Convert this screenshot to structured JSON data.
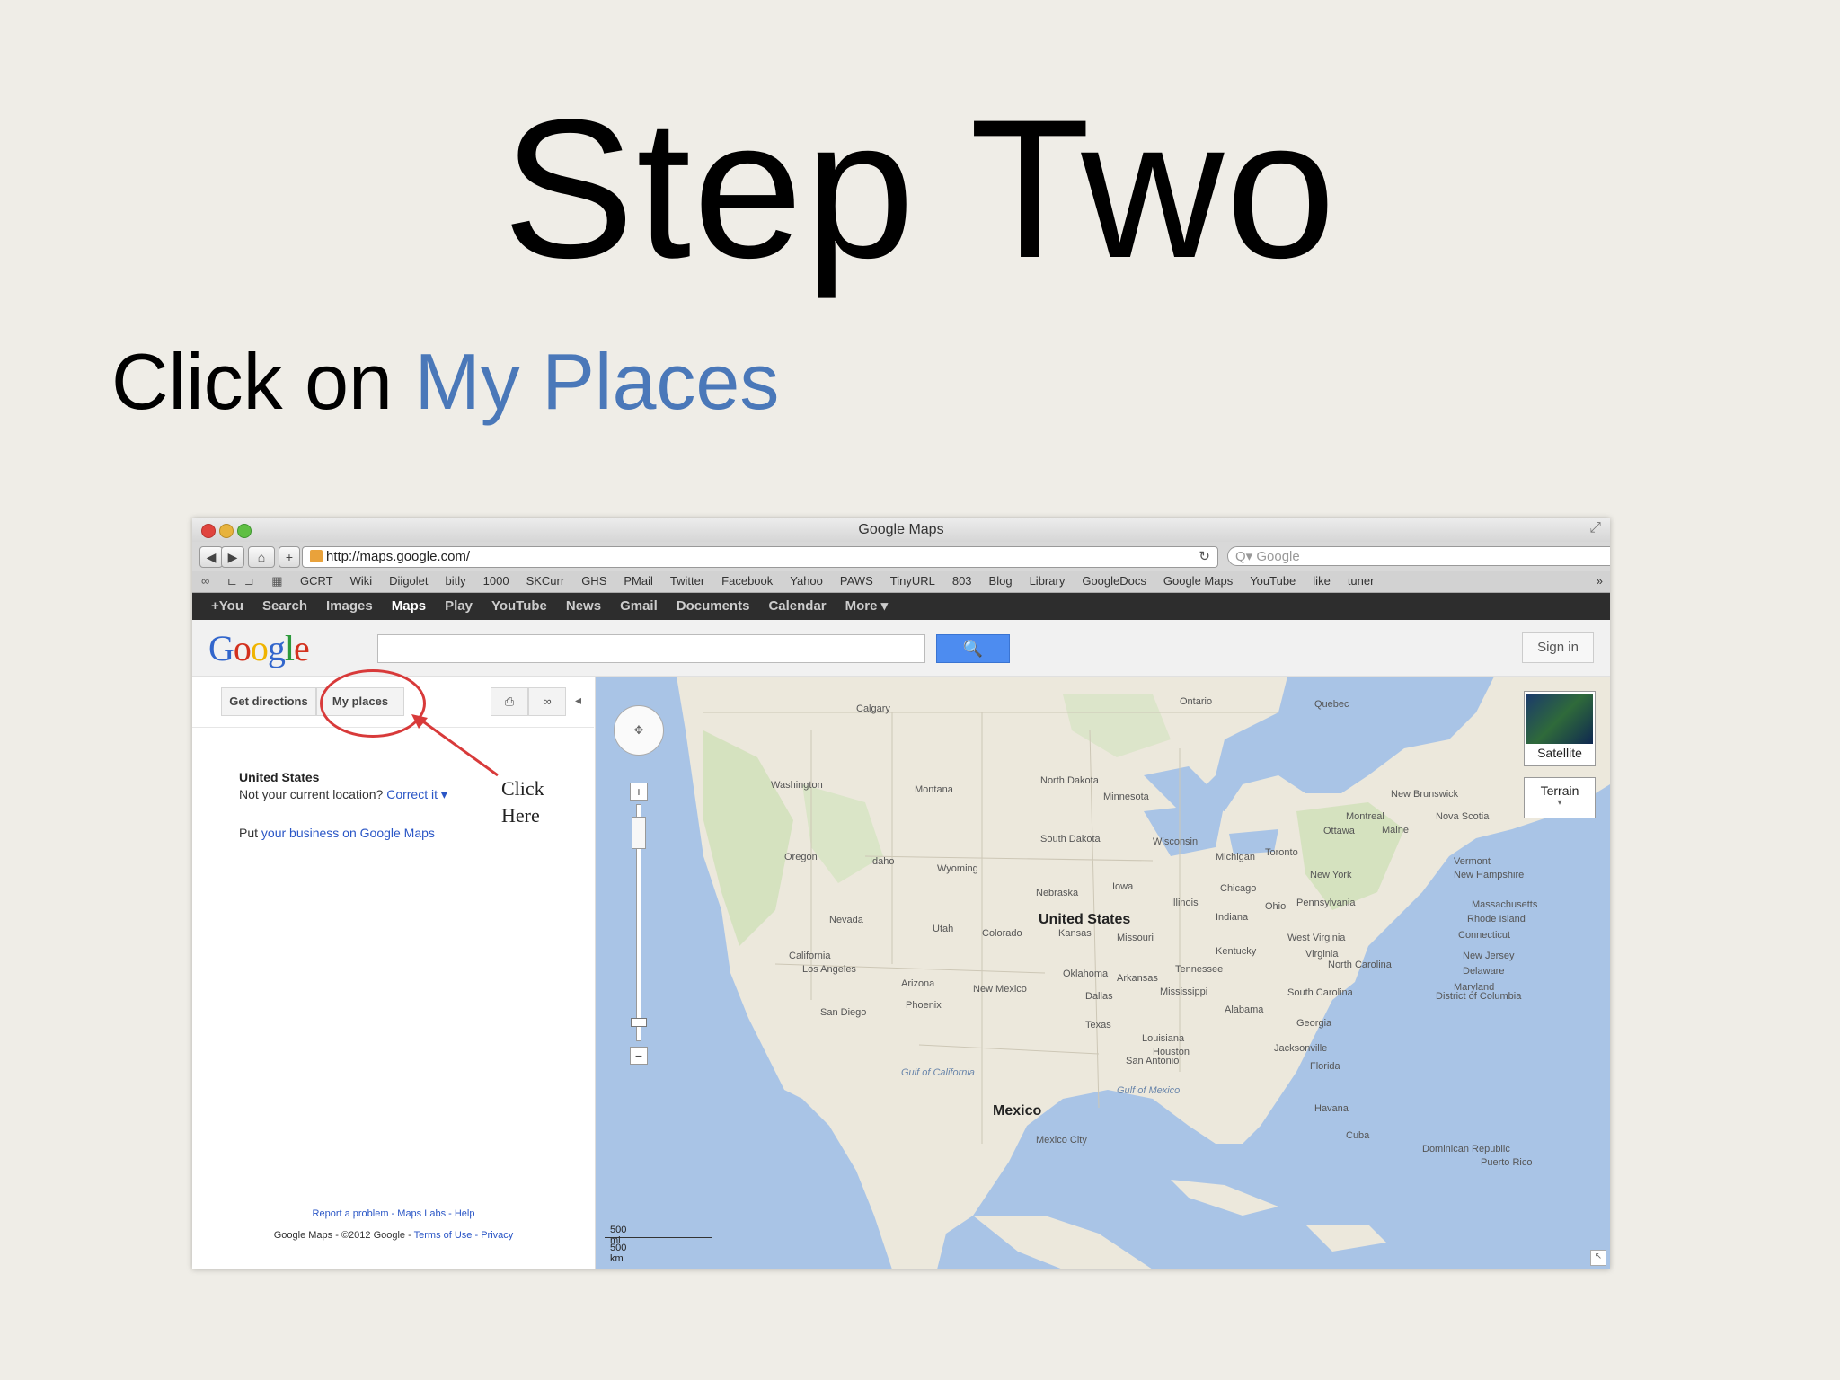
{
  "slide": {
    "title": "Step Two",
    "subtitle_prefix": "Click on ",
    "subtitle_highlight": "My Places"
  },
  "window": {
    "title": "Google Maps"
  },
  "toolbar": {
    "back": "◀",
    "forward": "▶",
    "home": "⌂",
    "add": "+",
    "url": "http://maps.google.com/",
    "reload": "↻",
    "search_placeholder": "Q▾ Google",
    "extension": "O"
  },
  "bookmarks": {
    "icons": "∞ ⊏⊐ ▦",
    "items": [
      "GCRT",
      "Wiki",
      "Diigolet",
      "bitly",
      "1000",
      "SKCurr",
      "GHS",
      "PMail",
      "Twitter",
      "Facebook",
      "Yahoo",
      "PAWS",
      "TinyURL",
      "803",
      "Blog",
      "Library",
      "GoogleDocs",
      "Google Maps",
      "YouTube",
      "like",
      "tuner"
    ],
    "more": "»"
  },
  "gbar": {
    "items": [
      "+You",
      "Search",
      "Images",
      "Maps",
      "Play",
      "YouTube",
      "News",
      "Gmail",
      "Documents",
      "Calendar",
      "More ▾"
    ],
    "active_index": 3
  },
  "header": {
    "logo": [
      "G",
      "o",
      "o",
      "g",
      "l",
      "e"
    ],
    "search_value": "",
    "search_icon": "🔍",
    "signin": "Sign in"
  },
  "left": {
    "get_directions": "Get directions",
    "my_places": "My places",
    "print_icon": "⎙",
    "link_icon": "∞",
    "collapse_icon": "◂",
    "location_title": "United States",
    "location_text": "Not your current location? ",
    "location_link": "Correct it ▾",
    "put_text": "Put ",
    "put_link": "your business on Google Maps",
    "annotation": "Click Here",
    "footer_links": "Report a problem - Maps Labs - Help",
    "footer_copyright": "Google Maps - ©2012 Google - ",
    "footer_terms": "Terms of Use - Privacy"
  },
  "map": {
    "labels": [
      {
        "t": "Calgary"
      },
      {
        "t": "Ontario"
      },
      {
        "t": "Quebec"
      },
      {
        "t": "Washington"
      },
      {
        "t": "Montana"
      },
      {
        "t": "North Dakota"
      },
      {
        "t": "Minnesota"
      },
      {
        "t": "Oregon"
      },
      {
        "t": "Idaho"
      },
      {
        "t": "Wyoming"
      },
      {
        "t": "South Dakota"
      },
      {
        "t": "Wisconsin"
      },
      {
        "t": "Michigan"
      },
      {
        "t": "Toronto"
      },
      {
        "t": "Ottawa"
      },
      {
        "t": "Montreal"
      },
      {
        "t": "Maine"
      },
      {
        "t": "New Brunswick"
      },
      {
        "t": "Nova Scotia"
      },
      {
        "t": "Nebraska"
      },
      {
        "t": "Iowa"
      },
      {
        "t": "Chicago"
      },
      {
        "t": "New York"
      },
      {
        "t": "Vermont"
      },
      {
        "t": "New Hampshire"
      },
      {
        "t": "Nevada"
      },
      {
        "t": "Utah"
      },
      {
        "t": "Colorado"
      },
      {
        "t": "United States"
      },
      {
        "t": "Illinois"
      },
      {
        "t": "Indiana"
      },
      {
        "t": "Ohio"
      },
      {
        "t": "Pennsylvania"
      },
      {
        "t": "Massachusetts"
      },
      {
        "t": "Rhode Island"
      },
      {
        "t": "California"
      },
      {
        "t": "Kansas"
      },
      {
        "t": "Missouri"
      },
      {
        "t": "West Virginia"
      },
      {
        "t": "Kentucky"
      },
      {
        "t": "Virginia"
      },
      {
        "t": "Connecticut"
      },
      {
        "t": "New Jersey"
      },
      {
        "t": "Delaware"
      },
      {
        "t": "Maryland"
      },
      {
        "t": "Los Angeles"
      },
      {
        "t": "Arizona"
      },
      {
        "t": "New Mexico"
      },
      {
        "t": "Oklahoma"
      },
      {
        "t": "Arkansas"
      },
      {
        "t": "Tennessee"
      },
      {
        "t": "North Carolina"
      },
      {
        "t": "Phoenix"
      },
      {
        "t": "San Diego"
      },
      {
        "t": "Dallas"
      },
      {
        "t": "Mississippi"
      },
      {
        "t": "Alabama"
      },
      {
        "t": "South Carolina"
      },
      {
        "t": "District of Columbia"
      },
      {
        "t": "Texas"
      },
      {
        "t": "Georgia"
      },
      {
        "t": "Louisiana"
      },
      {
        "t": "Houston"
      },
      {
        "t": "San Antonio"
      },
      {
        "t": "Jacksonville"
      },
      {
        "t": "Florida"
      },
      {
        "t": "Gulf of California"
      },
      {
        "t": "Gulf of Mexico"
      },
      {
        "t": "Mexico"
      },
      {
        "t": "Havana"
      },
      {
        "t": "Cuba"
      },
      {
        "t": "Mexico City"
      },
      {
        "t": "Dominican Republic"
      },
      {
        "t": "Puerto Rico"
      }
    ],
    "satellite": "Satellite",
    "terrain": "Terrain",
    "terrain_caret": "▾",
    "scale_mi": "500 mi",
    "scale_km": "500 km",
    "pan_icon": "✥",
    "zoom_in": "+",
    "zoom_out": "−",
    "corner_icon": "↖"
  },
  "colors": {
    "highlight": "#4a78b9",
    "annotation_red": "#d83a3a",
    "map_water": "#a9c4e6",
    "map_land": "#eeeae0"
  }
}
